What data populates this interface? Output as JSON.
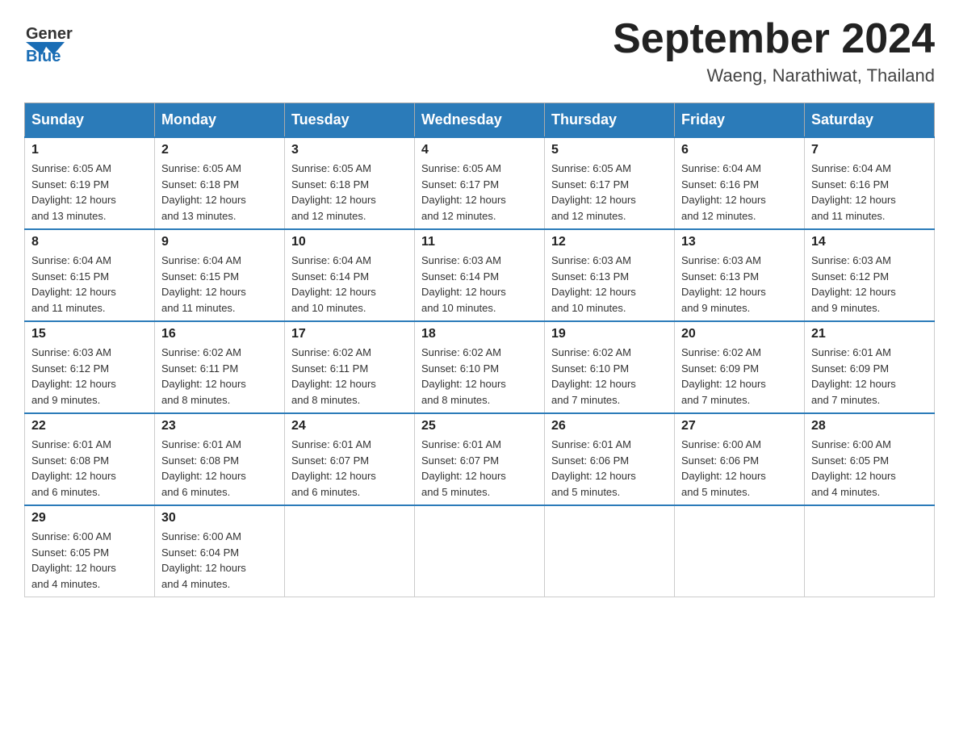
{
  "header": {
    "logo_text_general": "General",
    "logo_text_blue": "Blue",
    "month_title": "September 2024",
    "location": "Waeng, Narathiwat, Thailand"
  },
  "weekdays": [
    "Sunday",
    "Monday",
    "Tuesday",
    "Wednesday",
    "Thursday",
    "Friday",
    "Saturday"
  ],
  "weeks": [
    [
      {
        "day": "1",
        "sunrise": "6:05 AM",
        "sunset": "6:19 PM",
        "daylight": "12 hours and 13 minutes."
      },
      {
        "day": "2",
        "sunrise": "6:05 AM",
        "sunset": "6:18 PM",
        "daylight": "12 hours and 13 minutes."
      },
      {
        "day": "3",
        "sunrise": "6:05 AM",
        "sunset": "6:18 PM",
        "daylight": "12 hours and 12 minutes."
      },
      {
        "day": "4",
        "sunrise": "6:05 AM",
        "sunset": "6:17 PM",
        "daylight": "12 hours and 12 minutes."
      },
      {
        "day": "5",
        "sunrise": "6:05 AM",
        "sunset": "6:17 PM",
        "daylight": "12 hours and 12 minutes."
      },
      {
        "day": "6",
        "sunrise": "6:04 AM",
        "sunset": "6:16 PM",
        "daylight": "12 hours and 12 minutes."
      },
      {
        "day": "7",
        "sunrise": "6:04 AM",
        "sunset": "6:16 PM",
        "daylight": "12 hours and 11 minutes."
      }
    ],
    [
      {
        "day": "8",
        "sunrise": "6:04 AM",
        "sunset": "6:15 PM",
        "daylight": "12 hours and 11 minutes."
      },
      {
        "day": "9",
        "sunrise": "6:04 AM",
        "sunset": "6:15 PM",
        "daylight": "12 hours and 11 minutes."
      },
      {
        "day": "10",
        "sunrise": "6:04 AM",
        "sunset": "6:14 PM",
        "daylight": "12 hours and 10 minutes."
      },
      {
        "day": "11",
        "sunrise": "6:03 AM",
        "sunset": "6:14 PM",
        "daylight": "12 hours and 10 minutes."
      },
      {
        "day": "12",
        "sunrise": "6:03 AM",
        "sunset": "6:13 PM",
        "daylight": "12 hours and 10 minutes."
      },
      {
        "day": "13",
        "sunrise": "6:03 AM",
        "sunset": "6:13 PM",
        "daylight": "12 hours and 9 minutes."
      },
      {
        "day": "14",
        "sunrise": "6:03 AM",
        "sunset": "6:12 PM",
        "daylight": "12 hours and 9 minutes."
      }
    ],
    [
      {
        "day": "15",
        "sunrise": "6:03 AM",
        "sunset": "6:12 PM",
        "daylight": "12 hours and 9 minutes."
      },
      {
        "day": "16",
        "sunrise": "6:02 AM",
        "sunset": "6:11 PM",
        "daylight": "12 hours and 8 minutes."
      },
      {
        "day": "17",
        "sunrise": "6:02 AM",
        "sunset": "6:11 PM",
        "daylight": "12 hours and 8 minutes."
      },
      {
        "day": "18",
        "sunrise": "6:02 AM",
        "sunset": "6:10 PM",
        "daylight": "12 hours and 8 minutes."
      },
      {
        "day": "19",
        "sunrise": "6:02 AM",
        "sunset": "6:10 PM",
        "daylight": "12 hours and 7 minutes."
      },
      {
        "day": "20",
        "sunrise": "6:02 AM",
        "sunset": "6:09 PM",
        "daylight": "12 hours and 7 minutes."
      },
      {
        "day": "21",
        "sunrise": "6:01 AM",
        "sunset": "6:09 PM",
        "daylight": "12 hours and 7 minutes."
      }
    ],
    [
      {
        "day": "22",
        "sunrise": "6:01 AM",
        "sunset": "6:08 PM",
        "daylight": "12 hours and 6 minutes."
      },
      {
        "day": "23",
        "sunrise": "6:01 AM",
        "sunset": "6:08 PM",
        "daylight": "12 hours and 6 minutes."
      },
      {
        "day": "24",
        "sunrise": "6:01 AM",
        "sunset": "6:07 PM",
        "daylight": "12 hours and 6 minutes."
      },
      {
        "day": "25",
        "sunrise": "6:01 AM",
        "sunset": "6:07 PM",
        "daylight": "12 hours and 5 minutes."
      },
      {
        "day": "26",
        "sunrise": "6:01 AM",
        "sunset": "6:06 PM",
        "daylight": "12 hours and 5 minutes."
      },
      {
        "day": "27",
        "sunrise": "6:00 AM",
        "sunset": "6:06 PM",
        "daylight": "12 hours and 5 minutes."
      },
      {
        "day": "28",
        "sunrise": "6:00 AM",
        "sunset": "6:05 PM",
        "daylight": "12 hours and 4 minutes."
      }
    ],
    [
      {
        "day": "29",
        "sunrise": "6:00 AM",
        "sunset": "6:05 PM",
        "daylight": "12 hours and 4 minutes."
      },
      {
        "day": "30",
        "sunrise": "6:00 AM",
        "sunset": "6:04 PM",
        "daylight": "12 hours and 4 minutes."
      },
      null,
      null,
      null,
      null,
      null
    ]
  ],
  "labels": {
    "sunrise": "Sunrise:",
    "sunset": "Sunset:",
    "daylight": "Daylight:"
  }
}
